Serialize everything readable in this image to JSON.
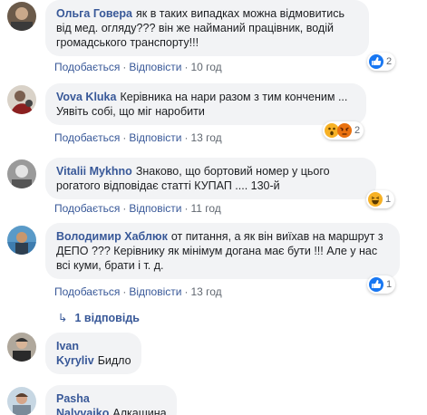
{
  "comments": [
    {
      "author": "Ольга Говера",
      "text": "як в таких випадках можна відмовитись від мед. огляду??? він же найманий працівник, водій громадського транспорту!!!",
      "like": "Подобається",
      "reply": "Відповісти",
      "time": "10 год",
      "reactions": {
        "icons": [
          "like-icon"
        ],
        "count": "2"
      }
    },
    {
      "author": "Vova Kluka",
      "text": "Керівника на нари разом з тим конченим ... Уявіть собі, що міг наробити",
      "like": "Подобається",
      "reply": "Відповісти",
      "time": "13 год",
      "reactions": {
        "icons": [
          "wow-icon",
          "angry-icon"
        ],
        "count": "2"
      }
    },
    {
      "author": "Vitalii Mykhno",
      "text": "Знаково, що бортовий номер у цього рогатого відповідає статті КУПАП .... 130-й",
      "like": "Подобається",
      "reply": "Відповісти",
      "time": "11 год",
      "reactions": {
        "icons": [
          "haha-icon"
        ],
        "count": "1"
      }
    },
    {
      "author": "Володимир Хаблюк",
      "text": "от питання, а як він виїхав на маршрут з ДЕПО ??? Керівнику як мінімум догана має бути !!! Але у нас всі куми, брати і т. д.",
      "like": "Подобається",
      "reply": "Відповісти",
      "time": "13 год",
      "reactions": {
        "icons": [
          "like-icon"
        ],
        "count": "1"
      }
    },
    {
      "author": "Ivan Kyryliv",
      "text": "Бидло"
    },
    {
      "author": "Pasha Nalyvaiko",
      "text": "Алкашина"
    }
  ],
  "replies_link": {
    "arrow": "↳",
    "label": "1 відповідь"
  },
  "colors": {
    "link": "#385898",
    "bubble": "#f2f3f5",
    "like": "#1877f2",
    "haha": "#f7b125",
    "angry": "#e9710f"
  }
}
